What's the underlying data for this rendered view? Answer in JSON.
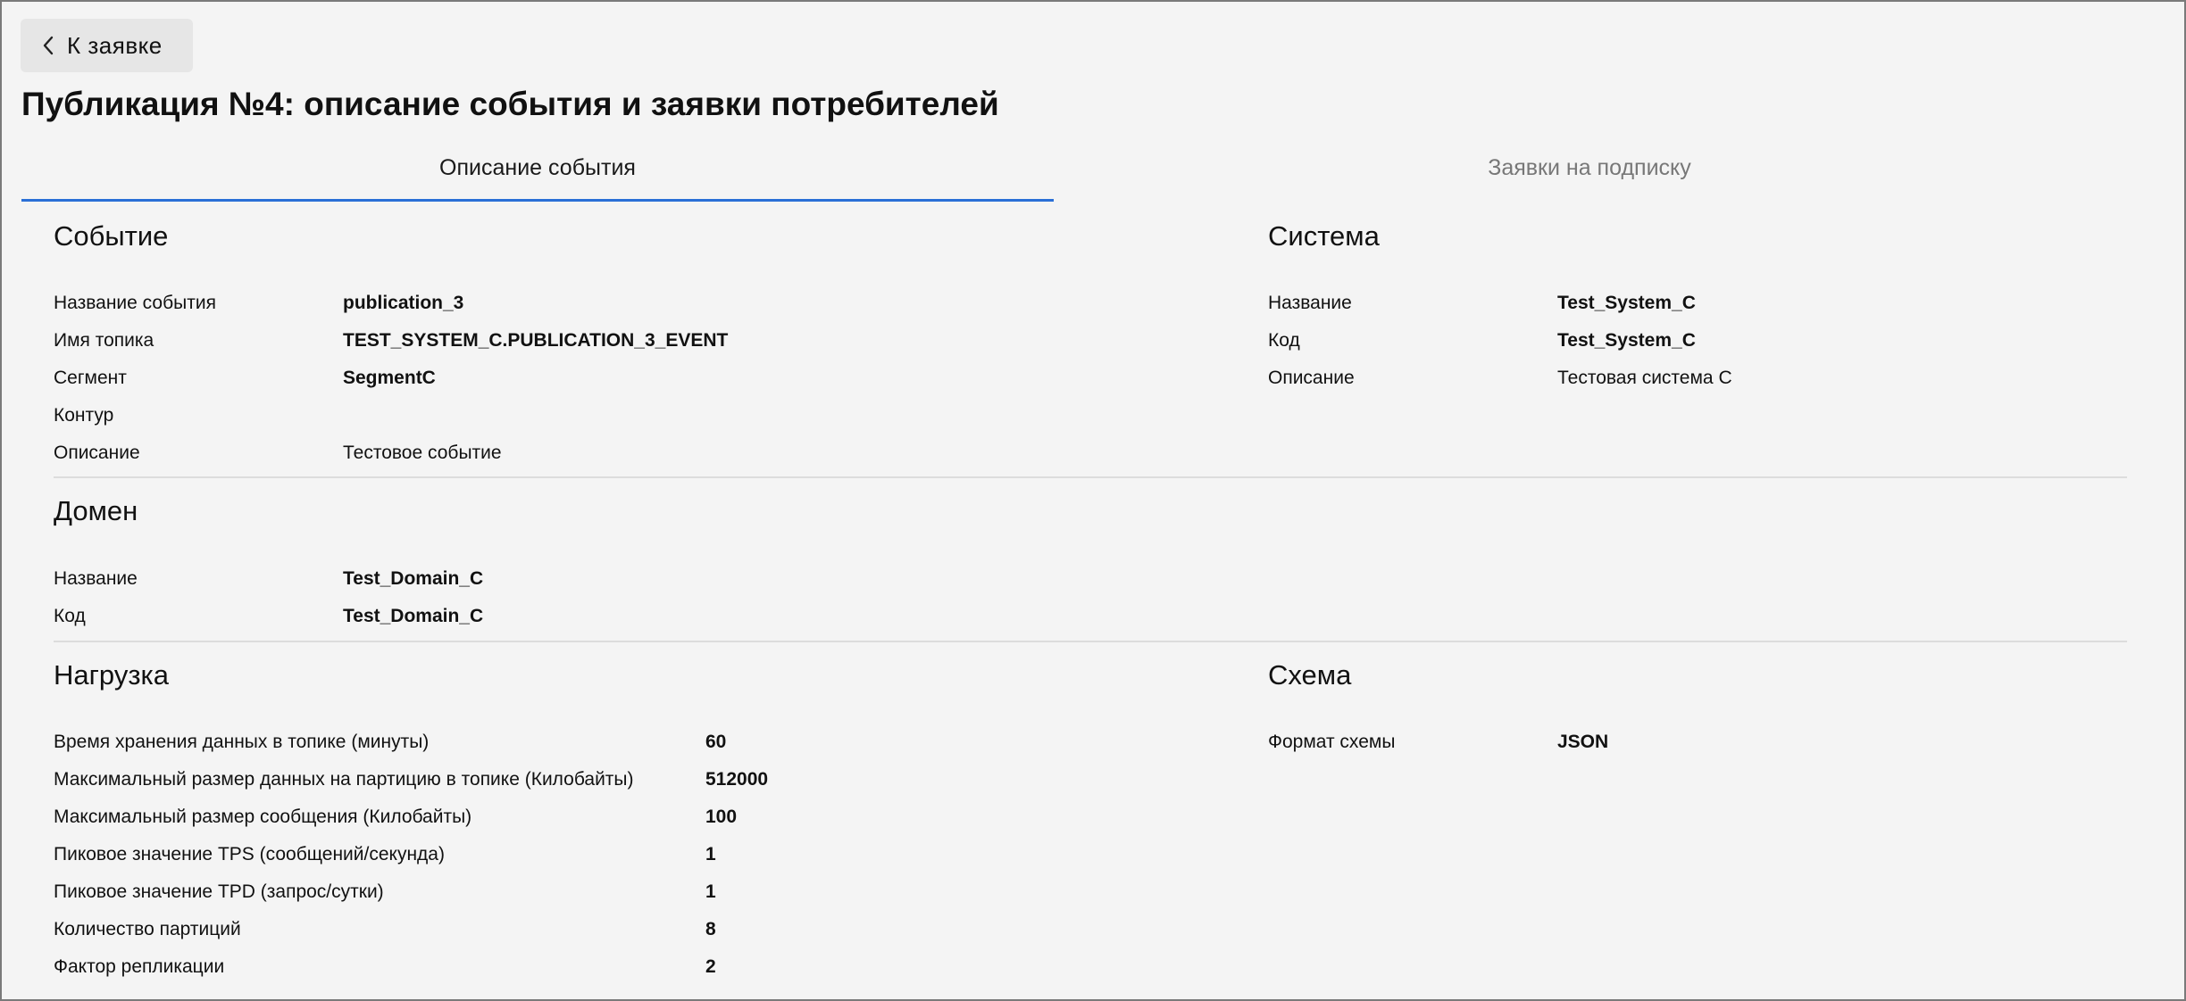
{
  "back_button": {
    "label": "К заявке"
  },
  "page_title": "Публикация №4: описание события и заявки потребителей",
  "tabs": [
    {
      "label": "Описание события",
      "active": true
    },
    {
      "label": "Заявки на подписку",
      "active": false
    }
  ],
  "event": {
    "title": "Событие",
    "rows": [
      {
        "label": "Название события",
        "value": "publication_3"
      },
      {
        "label": "Имя топика",
        "value": "TEST_SYSTEM_C.PUBLICATION_3_EVENT"
      },
      {
        "label": "Сегмент",
        "value": "SegmentC"
      },
      {
        "label": "Контур",
        "value": ""
      },
      {
        "label": "Описание",
        "value": "Тестовое событие"
      }
    ]
  },
  "system": {
    "title": "Система",
    "rows": [
      {
        "label": "Название",
        "value": "Test_System_C"
      },
      {
        "label": "Код",
        "value": "Test_System_C"
      },
      {
        "label": "Описание",
        "value": "Тестовая система C"
      }
    ]
  },
  "domain": {
    "title": "Домен",
    "rows": [
      {
        "label": "Название",
        "value": "Test_Domain_C"
      },
      {
        "label": "Код",
        "value": "Test_Domain_C"
      }
    ]
  },
  "load": {
    "title": "Нагрузка",
    "rows": [
      {
        "label": "Время хранения данных в топике (минуты)",
        "value": "60"
      },
      {
        "label": "Максимальный размер данных на партицию в топике (Килобайты)",
        "value": "512000"
      },
      {
        "label": "Максимальный размер сообщения (Килобайты)",
        "value": "100"
      },
      {
        "label": "Пиковое значение TPS (сообщений/секунда)",
        "value": "1"
      },
      {
        "label": "Пиковое значение TPD (запрос/сутки)",
        "value": "1"
      },
      {
        "label": "Количество партиций",
        "value": "8"
      },
      {
        "label": "Фактор репликации",
        "value": "2"
      }
    ]
  },
  "schema": {
    "title": "Схема",
    "rows": [
      {
        "label": "Формат схемы",
        "value": "JSON"
      }
    ]
  },
  "colors": {
    "tab_active_underline": "#2a6fd6",
    "background": "#f4f4f4",
    "divider": "#dcdcdc"
  }
}
